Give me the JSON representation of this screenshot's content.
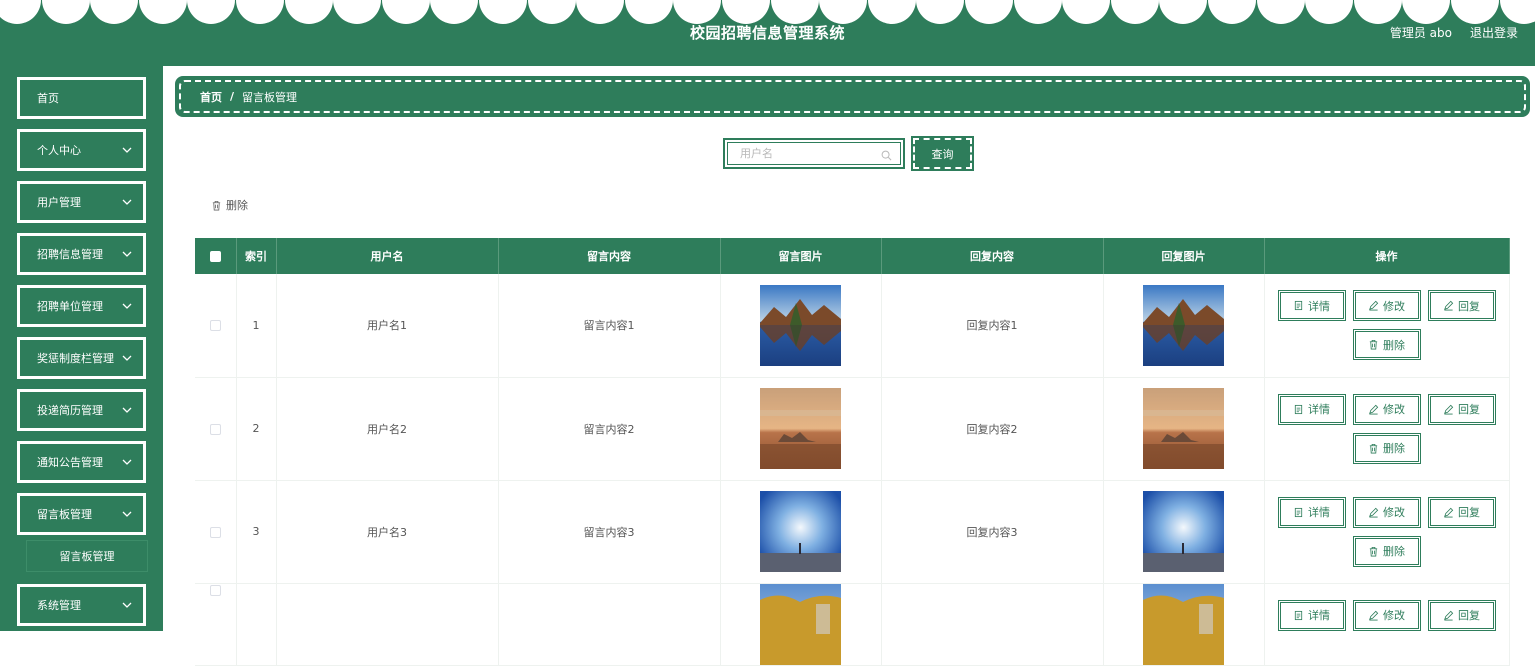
{
  "header": {
    "title": "校园招聘信息管理系统",
    "user": "管理员 abo",
    "logout": "退出登录"
  },
  "sidebar": {
    "items": [
      {
        "label": "首页",
        "has_chevron": false
      },
      {
        "label": "个人中心",
        "has_chevron": true
      },
      {
        "label": "用户管理",
        "has_chevron": true
      },
      {
        "label": "招聘信息管理",
        "has_chevron": true
      },
      {
        "label": "招聘单位管理",
        "has_chevron": true
      },
      {
        "label": "奖惩制度栏管理",
        "has_chevron": true
      },
      {
        "label": "投递简历管理",
        "has_chevron": true
      },
      {
        "label": "通知公告管理",
        "has_chevron": true
      },
      {
        "label": "留言板管理",
        "has_chevron": true
      },
      {
        "label": "系统管理",
        "has_chevron": true
      }
    ],
    "submenu": {
      "label": "留言板管理"
    }
  },
  "breadcrumb": {
    "home": "首页",
    "separator": "/",
    "current": "留言板管理"
  },
  "search": {
    "placeholder": "用户名",
    "button": "查询"
  },
  "toolbar": {
    "delete": "删除"
  },
  "table": {
    "columns": [
      "索引",
      "用户名",
      "留言内容",
      "留言图片",
      "回复内容",
      "回复图片",
      "操作"
    ],
    "rows": [
      {
        "index": "1",
        "username": "用户名1",
        "content": "留言内容1",
        "reply": "回复内容1",
        "image": "lake-mountains"
      },
      {
        "index": "2",
        "username": "用户名2",
        "content": "留言内容2",
        "reply": "回复内容2",
        "image": "sunset-sea"
      },
      {
        "index": "3",
        "username": "用户名3",
        "content": "留言内容3",
        "reply": "回复内容3",
        "image": "blue-sky-figure"
      },
      {
        "index": "",
        "username": "",
        "content": "",
        "reply": "",
        "image": "autumn-tower"
      }
    ],
    "actions": {
      "detail": "详情",
      "edit": "修改",
      "reply": "回复",
      "delete": "删除"
    }
  },
  "colors": {
    "primary": "#2e7d5b",
    "white": "#ffffff"
  }
}
